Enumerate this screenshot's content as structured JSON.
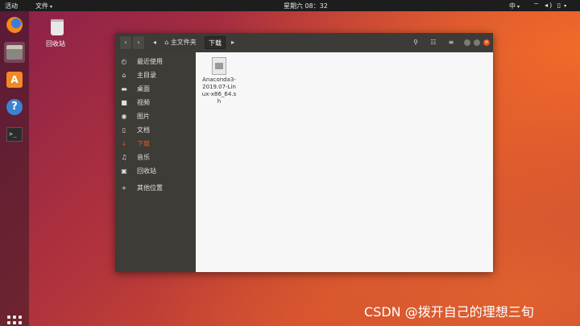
{
  "topbar": {
    "activities": "活动",
    "app_menu": "文件",
    "clock": "星期六 08：32",
    "input_source": "中",
    "tray": "≡ 🔈 🔋"
  },
  "desktop": {
    "trash_label": "回收站"
  },
  "window": {
    "breadcrumb_home": "主文件夹",
    "breadcrumb_current": "下载",
    "sidebar": [
      {
        "icon": "clock-icon",
        "glyph": "◴",
        "label": "最近使用"
      },
      {
        "icon": "home-icon",
        "glyph": "⌂",
        "label": "主目录"
      },
      {
        "icon": "folder-icon",
        "glyph": "▬",
        "label": "桌面"
      },
      {
        "icon": "video-icon",
        "glyph": "■",
        "label": "视频"
      },
      {
        "icon": "camera-icon",
        "glyph": "◉",
        "label": "图片"
      },
      {
        "icon": "document-icon",
        "glyph": "▯",
        "label": "文档"
      },
      {
        "icon": "download-icon",
        "glyph": "↓",
        "label": "下载"
      },
      {
        "icon": "music-icon",
        "glyph": "♫",
        "label": "音乐"
      },
      {
        "icon": "trash-icon",
        "glyph": "▣",
        "label": "回收站"
      },
      {
        "icon": "plus-icon",
        "glyph": "+",
        "label": "其他位置"
      }
    ],
    "files": [
      {
        "name": "Anaconda3-2019.07-Linux-x86_64.sh"
      }
    ]
  },
  "watermark": "CSDN @拨开自己的理想三旬"
}
